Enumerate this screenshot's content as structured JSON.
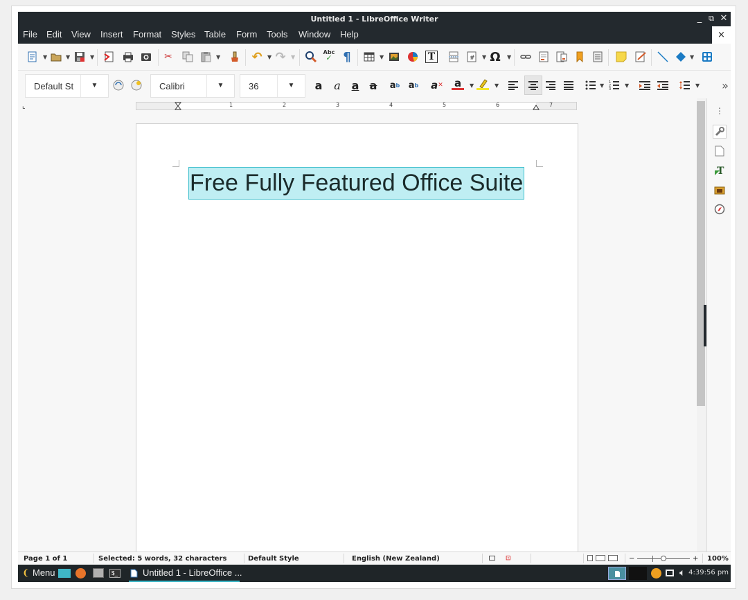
{
  "window": {
    "title": "Untitled 1 - LibreOffice Writer",
    "minimize": "_",
    "restore": "⧉",
    "close": "✕"
  },
  "menubar": {
    "items": [
      "File",
      "Edit",
      "View",
      "Insert",
      "Format",
      "Styles",
      "Table",
      "Form",
      "Tools",
      "Window",
      "Help"
    ],
    "doc_close": "×"
  },
  "toolbar": {
    "special_char": "Ω",
    "overflow": "»"
  },
  "formatting": {
    "paragraph_style": "Default St",
    "font_name": "Calibri",
    "font_size": "36"
  },
  "ruler": {
    "numbers": [
      "1",
      "2",
      "3",
      "4",
      "5",
      "6",
      "7"
    ]
  },
  "document": {
    "text": "Free Fully Featured Office Suite"
  },
  "statusbar": {
    "page": "Page 1 of 1",
    "selection": "Selected: 5 words, 32 characters",
    "page_style": "Default Style",
    "language": "English (New Zealand)",
    "zoom_minus": "−",
    "zoom_plus": "+",
    "zoom": "100%"
  },
  "taskbar": {
    "menu": "Menu",
    "task": "Untitled 1 - LibreOffice ...",
    "clock": "4:39:56 pm"
  },
  "colors": {
    "titlebar": "#23292e",
    "selection_bg": "#bfeef3",
    "selection_border": "#41c0cd",
    "accent": "#3fb7c7"
  },
  "icons": [
    "new-document-icon",
    "open-icon",
    "save-icon",
    "export-pdf-icon",
    "print-icon",
    "print-preview-icon",
    "cut-icon",
    "copy-icon",
    "paste-icon",
    "clone-formatting-icon",
    "undo-icon",
    "redo-icon",
    "find-replace-icon",
    "spellcheck-icon",
    "formatting-marks-icon",
    "insert-table-icon",
    "insert-image-icon",
    "insert-chart-icon",
    "insert-textbox-icon",
    "page-break-icon",
    "insert-field-icon",
    "special-character-icon",
    "hyperlink-icon",
    "footnote-icon",
    "endnote-icon",
    "bookmark-icon",
    "cross-reference-icon",
    "comment-icon",
    "track-changes-icon",
    "line-icon",
    "basic-shapes-icon",
    "draw-functions-icon"
  ]
}
